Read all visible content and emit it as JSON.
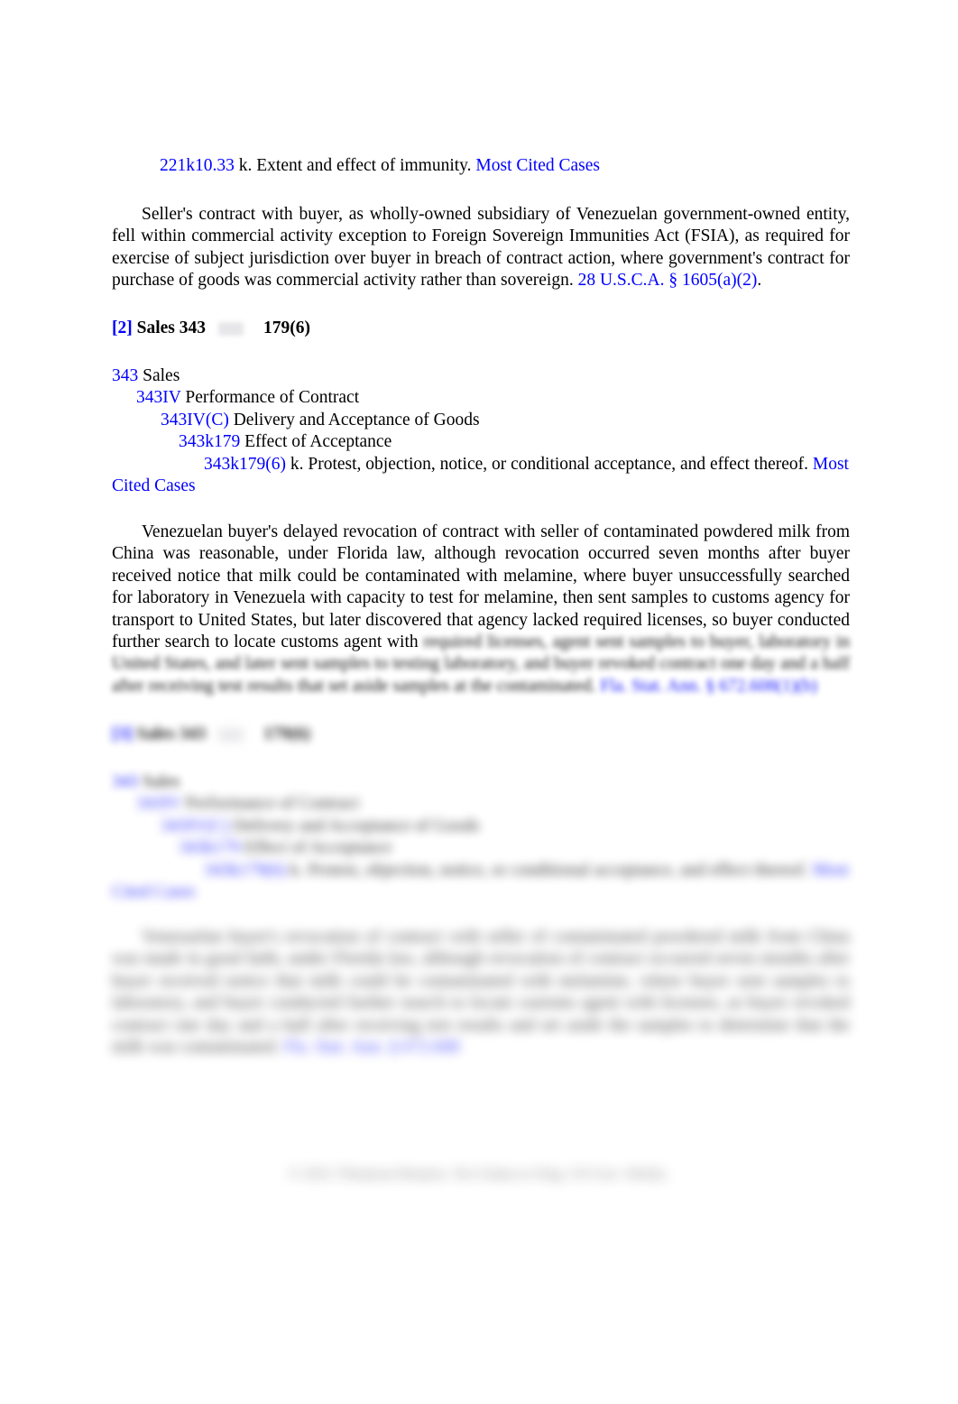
{
  "document": {
    "type": "legal-headnote-page",
    "link_color": "#0000ff",
    "text_color": "#000000"
  },
  "headnote_1": {
    "key_line": {
      "number": "221k10.33",
      "text": " k. Extent and effect of immunity. ",
      "most_cited": "Most Cited Cases"
    },
    "paragraph": {
      "text": "Seller's contract with buyer, as wholly-owned subsidiary of Venezuelan government-owned entity, fell within commercial activity exception to Foreign Sovereign Immunities Act (FSIA), as required for exercise of subject jurisdiction over buyer in breach of contract action, where government's contract for purchase of goods was commercial activity rather than sovereign. ",
      "citation": "28 U.S.C.A. § 1605(a)(2)",
      "citation_tail": "."
    }
  },
  "headnote_2": {
    "heading": {
      "bracket": "[2]",
      "topic": " Sales 343",
      "key_symbol": "key-symbol-image",
      "subsection": "179(6)"
    },
    "hierarchy": [
      {
        "number": "343",
        "label": " Sales",
        "indent": 0
      },
      {
        "number": "343IV",
        "label": " Performance of Contract",
        "indent": 1
      },
      {
        "number": "343IV(C)",
        "label": " Delivery and Acceptance of Goods",
        "indent": 2
      },
      {
        "number": "343k179",
        "label": " Effect of Acceptance",
        "indent": 3
      },
      {
        "number": "343k179(6)",
        "label": " k. Protest, objection, notice, or conditional acceptance, and effect thereof. ",
        "indent": 4,
        "most_cited": "Most Cited Cases"
      }
    ],
    "paragraph": {
      "text_visible": "Venezuelan buyer's delayed revocation of contract with seller of contaminated powdered milk from China was reasonable, under Florida law, although revocation occurred seven months after buyer received notice that milk could be contaminated with melamine, where buyer unsuccessfully searched for laboratory in Venezuela with capacity to test for melamine, then sent samples to customs agency for transport to United States, but later discovered that agency lacked required licenses, so buyer conducted further search to locate customs agent with ",
      "text_blurred": "required licenses, agent sent samples to buyer, laboratory in United States, and later sent samples to testing laboratory, and buyer revoked contract one day and a half after receiving test results that set aside samples at the contaminated. ",
      "citation_blurred": "Fla. Stat. Ann. § 672.608(1)(b)"
    }
  },
  "headnote_3_blurred": {
    "heading": {
      "bracket": "[3]",
      "topic": " Sales 343",
      "key_symbol": "key-symbol-image",
      "subsection": "179(6)"
    },
    "hierarchy": [
      {
        "number": "343",
        "label": " Sales",
        "indent": 0
      },
      {
        "number": "343IV",
        "label": " Performance of Contract",
        "indent": 1
      },
      {
        "number": "343IV(C)",
        "label": " Delivery and Acceptance of Goods",
        "indent": 2
      },
      {
        "number": "343k179",
        "label": " Effect of Acceptance",
        "indent": 3
      },
      {
        "number": "343k179(6)",
        "label": " k. Protest, objection, notice, or conditional acceptance, and effect thereof. ",
        "indent": 4,
        "most_cited": "Most Cited Cases"
      }
    ],
    "paragraph": {
      "text_blurred": "Venezuelan buyer's revocation of contract with seller of contaminated powdered milk from China was made in good faith, under Florida law, although revocation of contract occurred seven months after buyer received notice that milk could be contaminated with melamine, where buyer sent samples to laboratory, and buyer conducted further search to locate customs agent with licenses, as buyer revoked contract one day and a half after receiving test results and set aside the samples to determine that the milk was contaminated. ",
      "citation_blurred": "Fla. Stat. Ann. § 672.608"
    }
  },
  "footer": {
    "copyright": "© 2011 Thomson Reuters. No Claim to Orig. US Gov. Works."
  }
}
